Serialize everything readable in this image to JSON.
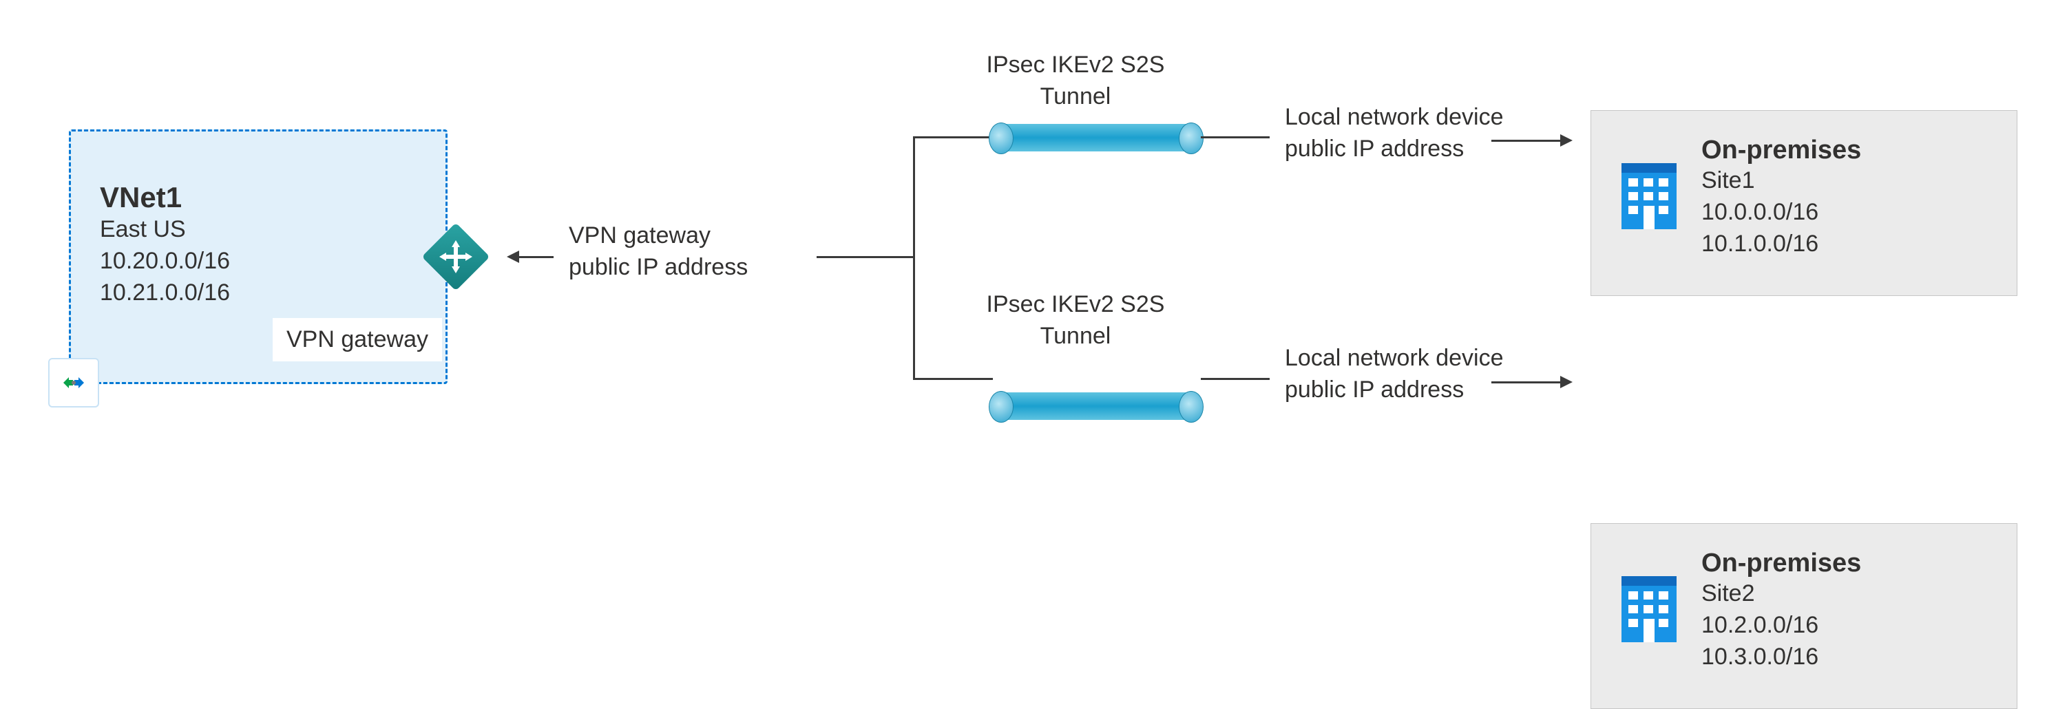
{
  "vnet": {
    "title": "VNet1",
    "region": "East US",
    "cidr1": "10.20.0.0/16",
    "cidr2": "10.21.0.0/16",
    "gateway_box_label": "VPN gateway"
  },
  "vpn_gateway_text": {
    "line1": "VPN gateway",
    "line2": "public IP address"
  },
  "tunnel_top": {
    "label_line1": "IPsec IKEv2 S2S",
    "label_line2": "Tunnel"
  },
  "tunnel_bottom": {
    "label_line1": "IPsec IKEv2 S2S",
    "label_line2": "Tunnel"
  },
  "local_top": {
    "line1": "Local network device",
    "line2": "public IP address"
  },
  "local_bottom": {
    "line1": "Local network device",
    "line2": "public IP address"
  },
  "onprem_top": {
    "title": "On-premises",
    "site": "Site1",
    "cidr1": "10.0.0.0/16",
    "cidr2": "10.1.0.0/16"
  },
  "onprem_bottom": {
    "title": "On-premises",
    "site": "Site2",
    "cidr1": "10.2.0.0/16",
    "cidr2": "10.3.0.0/16"
  },
  "icons": {
    "vnet_icon": "vnet-icon",
    "gateway_icon": "vpn-gateway-diamond-icon",
    "building_icon": "building-icon"
  }
}
